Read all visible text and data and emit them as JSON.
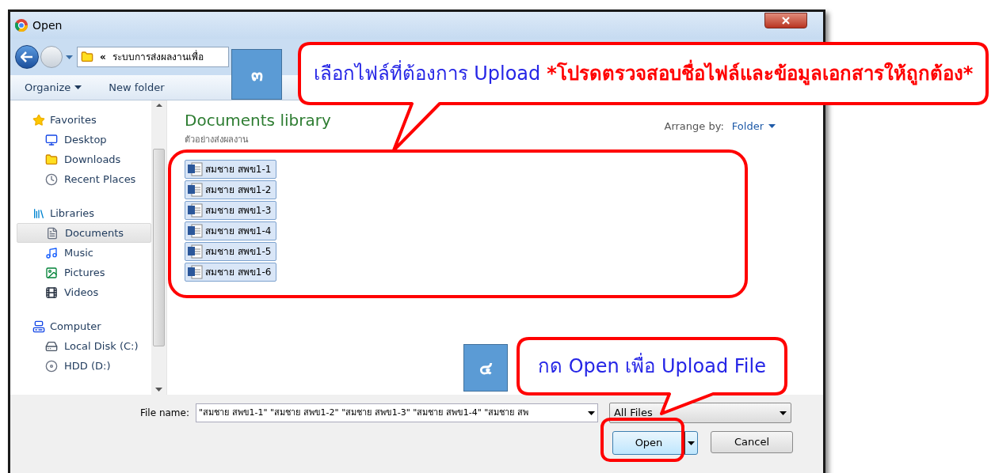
{
  "window": {
    "title": "Open"
  },
  "address": {
    "prefix": "«",
    "path": "ระบบการส่งผลงานเพื่อ"
  },
  "toolbar": {
    "organize": "Organize",
    "new_folder": "New folder"
  },
  "sidebar": {
    "groups": [
      {
        "label": "Favorites",
        "kind": "star",
        "children": [
          {
            "label": "Desktop",
            "kind": "desktop",
            "selected": false
          },
          {
            "label": "Downloads",
            "kind": "downloads",
            "selected": false
          },
          {
            "label": "Recent Places",
            "kind": "recent",
            "selected": false
          }
        ]
      },
      {
        "label": "Libraries",
        "kind": "library",
        "children": [
          {
            "label": "Documents",
            "kind": "documents",
            "selected": true
          },
          {
            "label": "Music",
            "kind": "music",
            "selected": false
          },
          {
            "label": "Pictures",
            "kind": "pictures",
            "selected": false
          },
          {
            "label": "Videos",
            "kind": "videos",
            "selected": false
          }
        ]
      },
      {
        "label": "Computer",
        "kind": "computer",
        "children": [
          {
            "label": "Local Disk (C:)",
            "kind": "disk",
            "selected": false
          },
          {
            "label": "HDD (D:)",
            "kind": "hdd",
            "selected": false
          }
        ]
      }
    ]
  },
  "library": {
    "title": "Documents library",
    "subtitle": "ตัวอย่างส่งผลงาน",
    "arrange_label": "Arrange by:",
    "arrange_value": "Folder"
  },
  "files": [
    {
      "name": "สมชาย สพข1-1",
      "selected": true
    },
    {
      "name": "สมชาย สพข1-2",
      "selected": true
    },
    {
      "name": "สมชาย สพข1-3",
      "selected": true
    },
    {
      "name": "สมชาย สพข1-4",
      "selected": true
    },
    {
      "name": "สมชาย สพข1-5",
      "selected": true
    },
    {
      "name": "สมชาย สพข1-6",
      "selected": true
    }
  ],
  "file_name": {
    "label": "File name:",
    "value": "\"สมชาย สพข1-1\" \"สมชาย สพข1-2\" \"สมชาย สพข1-3\" \"สมชาย สพข1-4\" \"สมชาย สพ"
  },
  "file_type": "All Files",
  "buttons": {
    "open": "Open",
    "cancel": "Cancel"
  },
  "annotations": [
    {
      "step": "๓",
      "text": "เลือกไฟล์ที่ต้องการ Upload",
      "note": "*โปรดตรวจสอบชื่อไฟล์และข้อมูลเอกสารให้ถูกต้อง*"
    },
    {
      "step": "๔",
      "text": "กด Open เพื่อ Upload File"
    }
  ]
}
